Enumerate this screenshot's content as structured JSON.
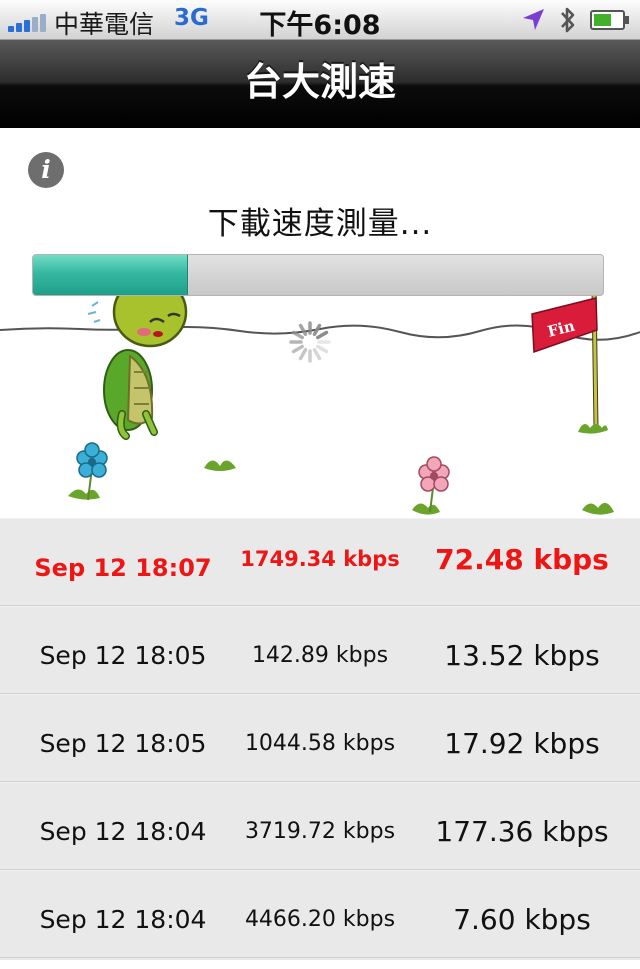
{
  "status_bar": {
    "carrier": "中華電信",
    "network": "3G",
    "time": "下午6:08",
    "icons": [
      "signal-icon",
      "location-arrow-icon",
      "bluetooth-icon",
      "battery-icon"
    ]
  },
  "nav": {
    "title": "台大測速"
  },
  "test": {
    "status_label": "下載速度測量...",
    "progress_percent": 27
  },
  "results": [
    {
      "date": "Sep 12 18:07",
      "rate": "1749.34 kbps",
      "speed": "72.48 kbps",
      "highlight": true
    },
    {
      "date": "Sep 12 18:05",
      "rate": "142.89 kbps",
      "speed": "13.52 kbps",
      "highlight": false
    },
    {
      "date": "Sep 12 18:05",
      "rate": "1044.58 kbps",
      "speed": "17.92 kbps",
      "highlight": false
    },
    {
      "date": "Sep 12 18:04",
      "rate": "3719.72 kbps",
      "speed": "177.36 kbps",
      "highlight": false
    },
    {
      "date": "Sep 12 18:04",
      "rate": "4466.20 kbps",
      "speed": "7.60 kbps",
      "highlight": false
    }
  ],
  "colors": {
    "highlight_text": "#ee1515",
    "progress_fill": "#36b8a0",
    "nav_bar": "#000000",
    "flag": "#d81c3a",
    "turtle": "#86b62a"
  }
}
